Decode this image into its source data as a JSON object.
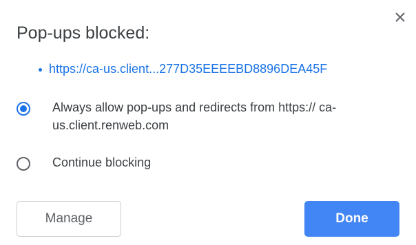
{
  "dialog": {
    "title": "Pop-ups blocked:",
    "close_icon": "close-icon",
    "blocked_urls": [
      "https://ca-us.client...277D35EEEEBD8896DEA45F"
    ],
    "options": [
      {
        "label": "Always allow pop-ups and redirects from https:// ca-us.client.renweb.com",
        "selected": true
      },
      {
        "label": "Continue blocking",
        "selected": false
      }
    ],
    "buttons": {
      "manage_label": "Manage",
      "done_label": "Done"
    }
  },
  "colors": {
    "accent": "#1a73e8",
    "primary_button": "#4285f4",
    "text": "#3c4043",
    "border": "#c9ccd1"
  }
}
